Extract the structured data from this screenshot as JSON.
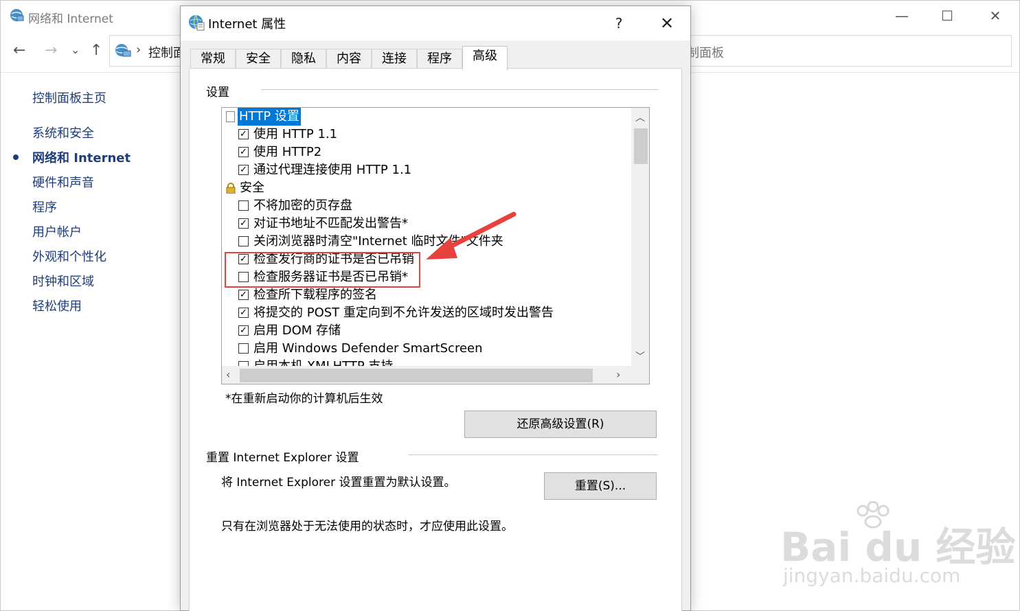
{
  "background_window": {
    "title": "网络和 Internet",
    "address_prefix": "控制面",
    "address_suffix": "制面板",
    "sidebar": [
      {
        "label": "控制面板主页",
        "active": false
      },
      {
        "label": "系统和安全",
        "active": false
      },
      {
        "label": "网络和 Internet",
        "active": true
      },
      {
        "label": "硬件和声音",
        "active": false
      },
      {
        "label": "程序",
        "active": false
      },
      {
        "label": "用户帐户",
        "active": false
      },
      {
        "label": "外观和个性化",
        "active": false
      },
      {
        "label": "时钟和区域",
        "active": false
      },
      {
        "label": "轻松使用",
        "active": false
      }
    ],
    "controls": {
      "minimize": "—",
      "maximize": "☐",
      "close": "✕"
    },
    "nav": {
      "back": "←",
      "forward": "→",
      "dropdown": "⌄",
      "up": "↑",
      "sep": "›"
    }
  },
  "dialog": {
    "title": "Internet 属性",
    "help": "?",
    "close": "✕",
    "tabs": [
      {
        "label": "常规",
        "active": false
      },
      {
        "label": "安全",
        "active": false
      },
      {
        "label": "隐私",
        "active": false
      },
      {
        "label": "内容",
        "active": false
      },
      {
        "label": "连接",
        "active": false
      },
      {
        "label": "程序",
        "active": false
      },
      {
        "label": "高级",
        "active": true
      }
    ],
    "settings_group_label": "设置",
    "settings": [
      {
        "type": "category",
        "icon": "document-icon",
        "label": "HTTP 设置",
        "highlighted": true
      },
      {
        "type": "checkbox",
        "checked": true,
        "label": "使用 HTTP 1.1"
      },
      {
        "type": "checkbox",
        "checked": true,
        "label": "使用 HTTP2"
      },
      {
        "type": "checkbox",
        "checked": true,
        "label": "通过代理连接使用 HTTP 1.1"
      },
      {
        "type": "category",
        "icon": "lock-icon",
        "label": "安全",
        "highlighted": false
      },
      {
        "type": "checkbox",
        "checked": false,
        "label": "不将加密的页存盘"
      },
      {
        "type": "checkbox",
        "checked": true,
        "label": "对证书地址不匹配发出警告*"
      },
      {
        "type": "checkbox",
        "checked": false,
        "label": "关闭浏览器时清空\"Internet 临时文件\"文件夹"
      },
      {
        "type": "checkbox",
        "checked": true,
        "label": "检查发行商的证书是否已吊销"
      },
      {
        "type": "checkbox",
        "checked": false,
        "label": "检查服务器证书是否已吊销*"
      },
      {
        "type": "checkbox",
        "checked": true,
        "label": "检查所下载程序的签名"
      },
      {
        "type": "checkbox",
        "checked": true,
        "label": "将提交的 POST 重定向到不允许发送的区域时发出警告"
      },
      {
        "type": "checkbox",
        "checked": true,
        "label": "启用 DOM 存储"
      },
      {
        "type": "checkbox",
        "checked": false,
        "label": "启用 Windows Defender SmartScreen"
      },
      {
        "type": "checkbox",
        "checked": false,
        "label": "启用本机 XMLHTTP 支持"
      }
    ],
    "restart_note": "*在重新启动你的计算机后生效",
    "restore_button": "还原高级设置(R)",
    "reset_group_label": "重置 Internet Explorer 设置",
    "reset_description": "将 Internet Explorer 设置重置为默认设置。",
    "reset_button": "重置(S)...",
    "reset_warning": "只有在浏览器处于无法使用的状态时，才应使用此设置。"
  },
  "watermark": {
    "main": "Bai du 经验",
    "sub": "jingyan.baidu.com"
  },
  "colors": {
    "accent": "#0078d7",
    "annotation": "#e8423f",
    "link": "#1e3d7b"
  }
}
